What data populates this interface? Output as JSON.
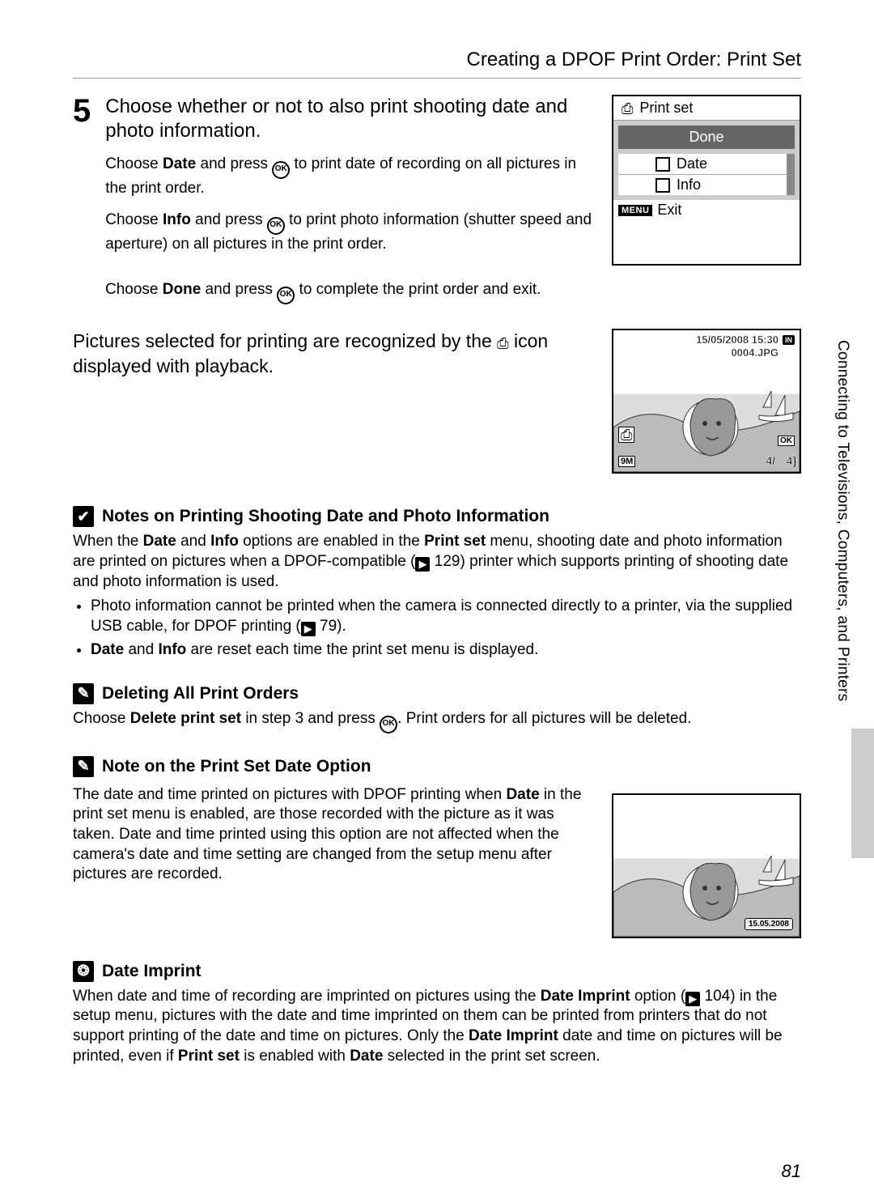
{
  "header": {
    "title": "Creating a DPOF Print Order: Print Set"
  },
  "step": {
    "number": "5",
    "title": "Choose whether or not to also print shooting date and photo information.",
    "p1_a": "Choose ",
    "p1_bold": "Date",
    "p1_b": " and press ",
    "p1_c": " to print date of recording on all pictures in the print order.",
    "p2_a": "Choose ",
    "p2_bold": "Info",
    "p2_b": " and press ",
    "p2_c": " to print photo information (shutter speed and aperture) on all pictures in the print order.",
    "p3_a": "Choose ",
    "p3_bold": "Done",
    "p3_b": " and press ",
    "p3_c": " to complete the print order and exit."
  },
  "lcd": {
    "title": "Print set",
    "done": "Done",
    "date": "Date",
    "info": "Info",
    "menu": "MENU",
    "exit": "Exit"
  },
  "playback_text_a": "Pictures selected for printing are recognized by the ",
  "playback_text_b": " icon displayed with playback.",
  "playback_thumb": {
    "datetime": "15/05/2008 15:30",
    "filename": "0004.JPG",
    "in": "IN",
    "ok": "OK",
    "nine_m": "9M",
    "count_pos": "4/",
    "count_total": "4]"
  },
  "notes1": {
    "title": "Notes on Printing Shooting Date and Photo Information",
    "p": {
      "a": "When the ",
      "b": "Date",
      "c": " and ",
      "d": "Info",
      "e": " options are enabled in the ",
      "f": "Print set",
      "g": " menu, shooting date and photo information are printed on pictures when a DPOF-compatible (",
      "h": " 129) printer which supports printing of shooting date and photo information is used."
    },
    "li1_a": "Photo information cannot be printed when the camera is connected directly to a printer, via the supplied USB cable, for DPOF printing (",
    "li1_b": " 79).",
    "li2_a": "Date",
    "li2_b": " and ",
    "li2_c": "Info",
    "li2_d": " are reset each time the print set menu is displayed."
  },
  "notes2": {
    "title": "Deleting All Print Orders",
    "a": "Choose ",
    "b": "Delete print set",
    "c": " in step 3 and press ",
    "d": ". Print orders for all pictures will be deleted."
  },
  "notes3": {
    "title_a": "Note on the Print Set ",
    "title_b": "Date",
    "title_c": " Option",
    "body_a": "The date and time printed on pictures with DPOF printing when ",
    "body_b": "Date",
    "body_c": " in the print set menu is enabled, are those recorded with the picture as it was taken. Date and time printed using this option are not affected when the camera's date and time setting are changed from the setup menu after pictures are recorded."
  },
  "thumb2": {
    "datestamp": "15.05.2008"
  },
  "notes4": {
    "title": "Date Imprint",
    "a": "When date and time of recording are imprinted on pictures using the ",
    "b": "Date Imprint",
    "c": " option (",
    "d": " 104) in the setup menu, pictures with the date and time imprinted on them can be printed from printers that do not support printing of the date and time on pictures. Only the ",
    "e": "Date Imprint",
    "f": " date and time on pictures will be printed, even if ",
    "g": "Print set",
    "h": " is enabled with ",
    "i": "Date",
    "j": " selected in the print set screen."
  },
  "side_text": "Connecting to Televisions, Computers, and Printers",
  "page_number": "81",
  "ok_glyph": "OK",
  "printer_glyph": "⎙",
  "check_glyph": "✔",
  "pencil_glyph": "✎",
  "bulb_glyph": "❂",
  "page_ref_glyph": "▶"
}
